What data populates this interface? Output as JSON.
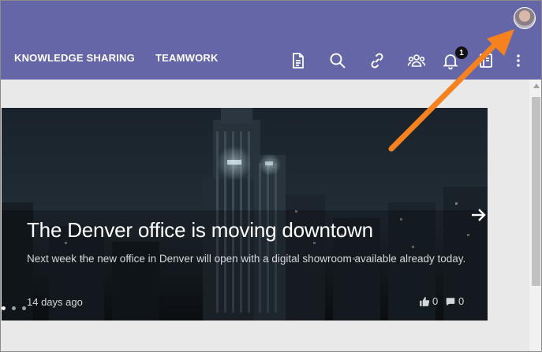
{
  "header": {
    "nav": [
      {
        "label": "KNOWLEDGE SHARING"
      },
      {
        "label": "TEAMWORK"
      }
    ],
    "icons": [
      "document-icon",
      "search-icon",
      "link-icon",
      "people-icon",
      "bell-icon",
      "book-icon",
      "more-vertical-icon"
    ],
    "notification_count": "1",
    "colors": {
      "header_bg": "#6466a8",
      "text": "#ffffff"
    }
  },
  "hero": {
    "title": "The Denver office is moving downtown",
    "description": "Next week the new office in Denver will open with a digital showroom available already today.",
    "date": "14 days ago",
    "likes": "0",
    "comments": "0"
  },
  "annotation": {
    "color": "#f5821f",
    "points_to": "avatar"
  }
}
